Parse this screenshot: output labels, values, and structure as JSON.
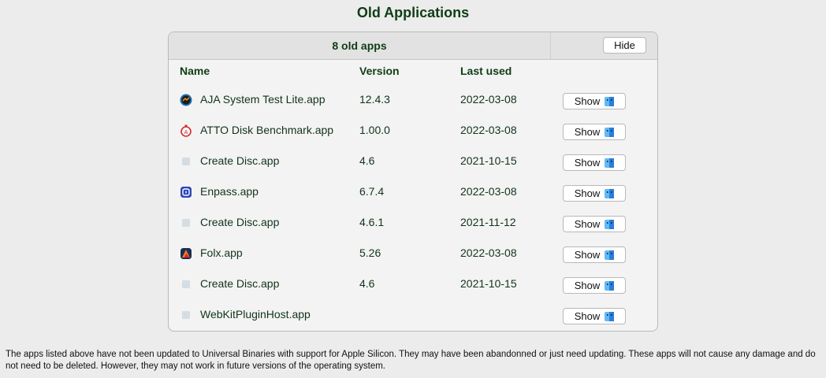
{
  "window": {
    "title": "Old Applications"
  },
  "panel": {
    "count_label": "8 old apps",
    "hide_label": "Hide",
    "columns": {
      "name": "Name",
      "version": "Version",
      "last_used": "Last used"
    },
    "show_label": "Show",
    "rows": [
      {
        "name": "AJA System Test Lite.app",
        "version": "12.4.3",
        "last_used": "2022-03-08",
        "icon": "aja-system-test-icon"
      },
      {
        "name": "ATTO Disk Benchmark.app",
        "version": "1.00.0",
        "last_used": "2022-03-08",
        "icon": "atto-disk-benchmark-icon"
      },
      {
        "name": "Create Disc.app",
        "version": "4.6",
        "last_used": "2021-10-15",
        "icon": "generic-app-icon"
      },
      {
        "name": "Enpass.app",
        "version": "6.7.4",
        "last_used": "2022-03-08",
        "icon": "enpass-icon"
      },
      {
        "name": "Create Disc.app",
        "version": "4.6.1",
        "last_used": "2021-11-12",
        "icon": "generic-app-icon"
      },
      {
        "name": "Folx.app",
        "version": "5.26",
        "last_used": "2022-03-08",
        "icon": "folx-icon"
      },
      {
        "name": "Create Disc.app",
        "version": "4.6",
        "last_used": "2021-10-15",
        "icon": "generic-app-icon"
      },
      {
        "name": "WebKitPluginHost.app",
        "version": "",
        "last_used": "",
        "icon": "generic-app-icon"
      }
    ]
  },
  "footer": {
    "text": "The apps listed above have not been updated to Universal Binaries with support for Apple Silicon. They may have been abandonned or just need updating. These apps will not cause any damage and do not need to be deleted. However, they may not work in future versions of the operating system."
  },
  "colors": {
    "title": "#0f3d14",
    "background": "#ececec",
    "panel": "#f3f3f3"
  }
}
